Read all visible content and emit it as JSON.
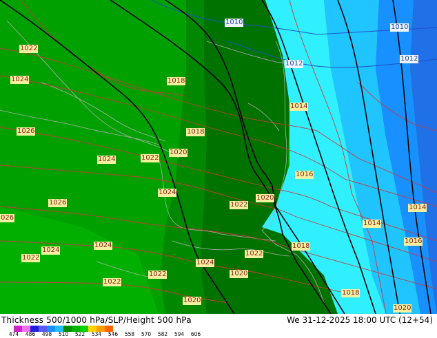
{
  "caption": "Thickness 500/1000 hPa/SLP/Height 500 hPa",
  "timestamp": "We 31-12-2025 18:00 UTC (12+54)",
  "legend": {
    "ticks": [
      "474",
      "486",
      "498",
      "510",
      "522",
      "534",
      "546",
      "558",
      "570",
      "582",
      "594",
      "606"
    ],
    "colors": [
      "#d020c8",
      "#f070f0",
      "#2020e0",
      "#5a5af0",
      "#1e90ff",
      "#20c0ff",
      "#008c00",
      "#00b400",
      "#00d200",
      "#ffd200",
      "#ffa000",
      "#ff6400"
    ]
  },
  "colors": {
    "green_west": "#00a000",
    "green_mid": "#008800",
    "green_dark": "#007200",
    "cyan": "#30f0ff",
    "light_blue": "#20c4ff",
    "blue": "#1890ff",
    "dark_blue": "#2070e8",
    "isobar": "#c83c3c",
    "height_line": "#000000",
    "coast": "#b0b0b0"
  },
  "slp_labels": [
    {
      "text": "1010",
      "style": "blue"
    },
    {
      "text": "1010",
      "style": "blue"
    },
    {
      "text": "1012",
      "style": "blue"
    },
    {
      "text": "1012",
      "style": "blue"
    },
    {
      "text": "1022",
      "style": "red"
    },
    {
      "text": "1024",
      "style": "red"
    },
    {
      "text": "1018",
      "style": "red"
    },
    {
      "text": "1014",
      "style": "red"
    },
    {
      "text": "1026",
      "style": "red"
    },
    {
      "text": "1018",
      "style": "red"
    },
    {
      "text": "1024",
      "style": "red"
    },
    {
      "text": "1022",
      "style": "red"
    },
    {
      "text": "1020",
      "style": "red"
    },
    {
      "text": "1016",
      "style": "red"
    },
    {
      "text": "1024",
      "style": "red"
    },
    {
      "text": "1026",
      "style": "red"
    },
    {
      "text": "1020",
      "style": "red"
    },
    {
      "text": "1022",
      "style": "red"
    },
    {
      "text": "1014",
      "style": "red"
    },
    {
      "text": "1014",
      "style": "red"
    },
    {
      "text": "026",
      "style": "red"
    },
    {
      "text": "1024",
      "style": "red"
    },
    {
      "text": "1024",
      "style": "red"
    },
    {
      "text": "1018",
      "style": "red"
    },
    {
      "text": "1016",
      "style": "red"
    },
    {
      "text": "1022",
      "style": "red"
    },
    {
      "text": "1022",
      "style": "red"
    },
    {
      "text": "1024",
      "style": "red"
    },
    {
      "text": "1020",
      "style": "red"
    },
    {
      "text": "1022",
      "style": "red"
    },
    {
      "text": "1022",
      "style": "red"
    },
    {
      "text": "1018",
      "style": "red"
    },
    {
      "text": "1020",
      "style": "red"
    },
    {
      "text": "1020",
      "style": "red"
    }
  ]
}
